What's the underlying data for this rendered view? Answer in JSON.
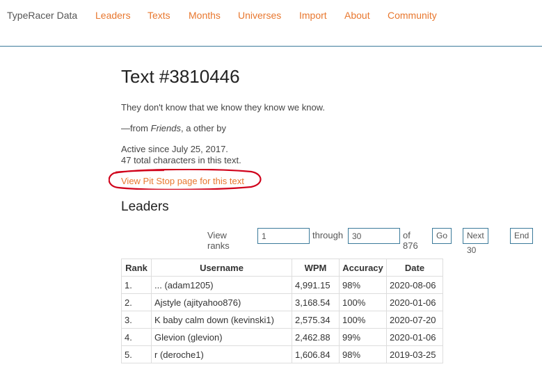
{
  "nav": {
    "brand": "TypeRacer Data",
    "links": [
      "Leaders",
      "Texts",
      "Months",
      "Universes",
      "Import",
      "About",
      "Community"
    ]
  },
  "page": {
    "title": "Text #3810446",
    "quote": "They don't know that we know they know we know.",
    "source_prefix": "—from ",
    "source_title": "Friends",
    "source_suffix": ", a other by",
    "active_since": "Active since July 25, 2017.",
    "char_count": "47 total characters in this text.",
    "pit_stop_link": "View Pit Stop page for this text",
    "leaders_heading": "Leaders"
  },
  "pager": {
    "view_ranks_label": "View ranks",
    "from_value": "1",
    "through_label": "through",
    "to_value": "30",
    "of_label": "of 876",
    "go_label": "Go",
    "next_label": "Next 30",
    "end_label": "End"
  },
  "table": {
    "headers": [
      "Rank",
      "Username",
      "WPM",
      "Accuracy",
      "Date"
    ],
    "rows": [
      [
        "1.",
        "... (adam1205)",
        "4,991.15",
        "98%",
        "2020-08-06"
      ],
      [
        "2.",
        "Ajstyle (ajityahoo876)",
        "3,168.54",
        "100%",
        "2020-01-06"
      ],
      [
        "3.",
        "K baby calm down (kevinski1)",
        "2,575.34",
        "100%",
        "2020-07-20"
      ],
      [
        "4.",
        "Glevion (glevion)",
        "2,462.88",
        "99%",
        "2020-01-06"
      ],
      [
        "5.",
        "r (deroche1)",
        "1,606.84",
        "98%",
        "2019-03-25"
      ]
    ]
  },
  "colors": {
    "link": "#e8772e",
    "border": "#3b7a9a",
    "annotation": "#d0021b"
  }
}
